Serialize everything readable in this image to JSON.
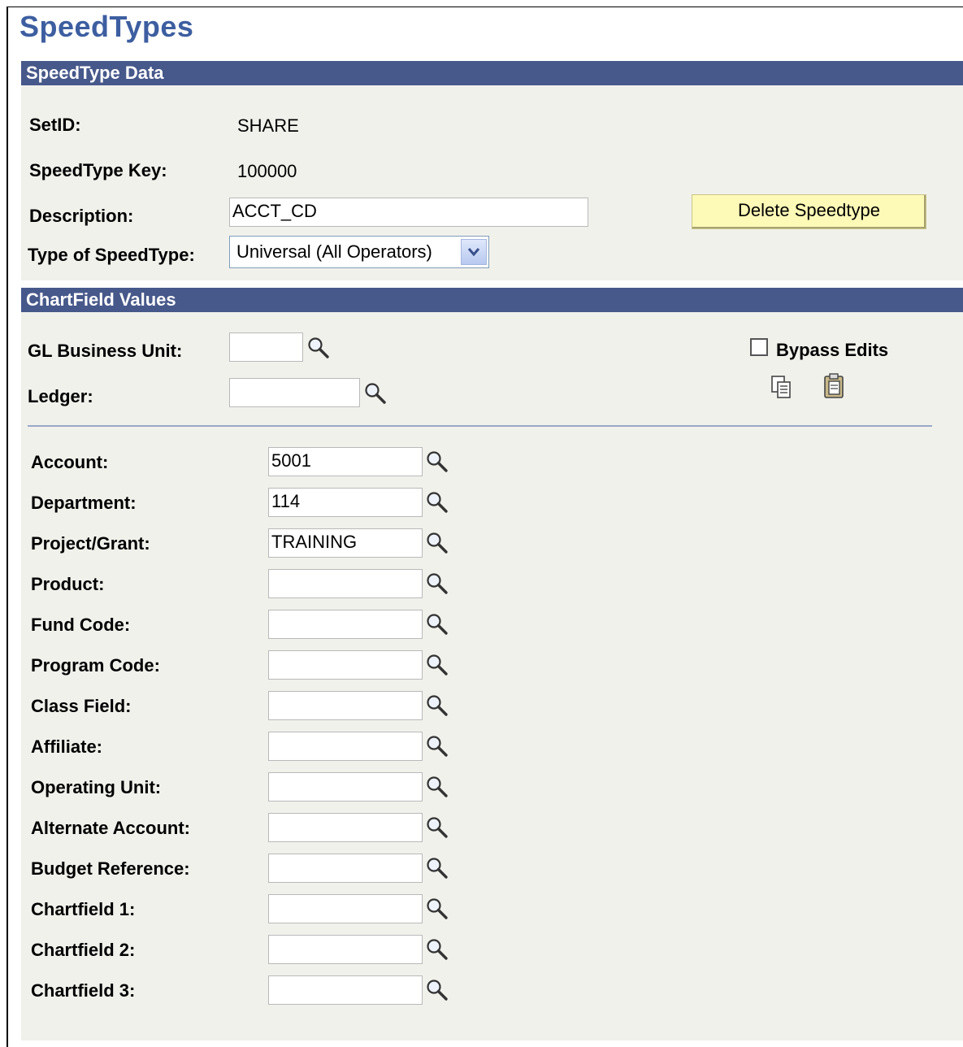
{
  "page": {
    "title": "SpeedTypes"
  },
  "speedtype_data": {
    "header": "SpeedType Data",
    "setid_label": "SetID:",
    "setid_value": "SHARE",
    "key_label": "SpeedType Key:",
    "key_value": "100000",
    "description_label": "Description:",
    "description_value": "ACCT_CD",
    "type_label": "Type of SpeedType:",
    "type_value": "Universal (All Operators)",
    "delete_button": "Delete Speedtype"
  },
  "chartfield_values": {
    "header": "ChartField Values",
    "gl_bu_label": "GL Business Unit:",
    "gl_bu_value": "",
    "ledger_label": "Ledger:",
    "ledger_value": "",
    "bypass_label": "Bypass Edits",
    "bypass_checked": false,
    "fields": [
      {
        "label": "Account:",
        "value": "5001"
      },
      {
        "label": "Department:",
        "value": "114"
      },
      {
        "label": "Project/Grant:",
        "value": "TRAINING"
      },
      {
        "label": "Product:",
        "value": ""
      },
      {
        "label": "Fund Code:",
        "value": ""
      },
      {
        "label": "Program Code:",
        "value": ""
      },
      {
        "label": "Class Field:",
        "value": ""
      },
      {
        "label": "Affiliate:",
        "value": ""
      },
      {
        "label": "Operating Unit:",
        "value": ""
      },
      {
        "label": "Alternate Account:",
        "value": ""
      },
      {
        "label": "Budget Reference:",
        "value": ""
      },
      {
        "label": "Chartfield 1:",
        "value": ""
      },
      {
        "label": "Chartfield 2:",
        "value": ""
      },
      {
        "label": "Chartfield 3:",
        "value": ""
      }
    ]
  },
  "icons": {
    "lookup": "magnifying-glass-icon",
    "copy": "copy-icon",
    "paste": "paste-icon",
    "dropdown": "chevron-down-icon"
  },
  "colors": {
    "title": "#3d5ea0",
    "section_header": "#47588a",
    "panel_bg": "#f1f1ec",
    "button_bg": "#fdf9b6"
  }
}
